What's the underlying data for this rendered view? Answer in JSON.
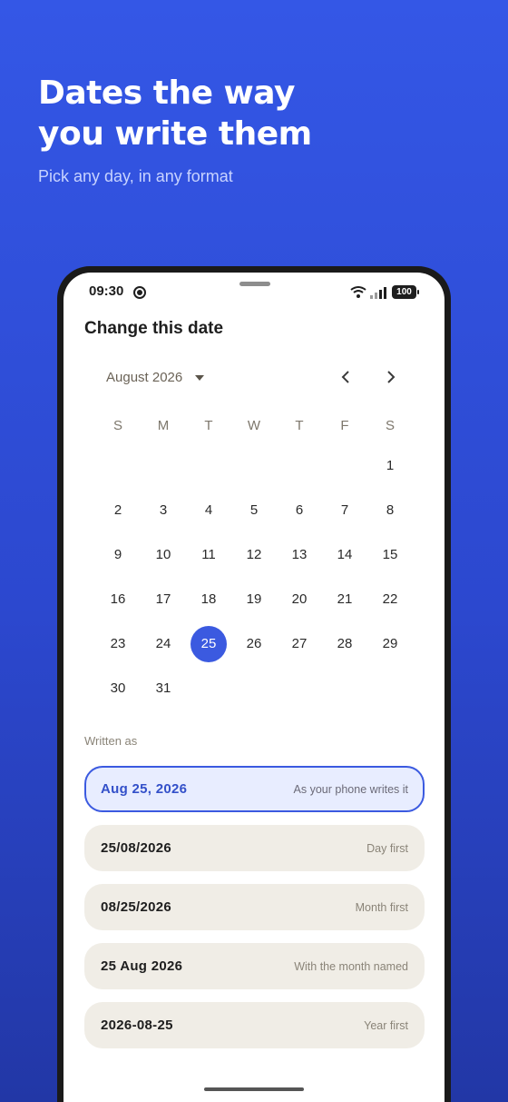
{
  "hero": {
    "title": "Dates the way\nyou write them",
    "subtitle": "Pick any day, in any format"
  },
  "status_bar": {
    "time": "09:30",
    "battery": "100",
    "icons": [
      "focus-mode-icon",
      "wifi-icon",
      "signal-icon",
      "battery-icon"
    ]
  },
  "sheet": {
    "title": "Change this date"
  },
  "calendar": {
    "month_label": "August 2026",
    "weekdays": [
      "S",
      "M",
      "T",
      "W",
      "T",
      "F",
      "S"
    ],
    "leading_blanks": 6,
    "days_in_month": 31,
    "selected_day": 25,
    "accent_color": "#3b5ae0"
  },
  "formats": {
    "section_label": "Written as",
    "options": [
      {
        "value": "Aug 25, 2026",
        "description": "As your phone writes it",
        "selected": true
      },
      {
        "value": "25/08/2026",
        "description": "Day first",
        "selected": false
      },
      {
        "value": "08/25/2026",
        "description": "Month first",
        "selected": false
      },
      {
        "value": "25 Aug 2026",
        "description": "With the month named",
        "selected": false
      },
      {
        "value": "2026-08-25",
        "description": "Year first",
        "selected": false
      }
    ]
  }
}
